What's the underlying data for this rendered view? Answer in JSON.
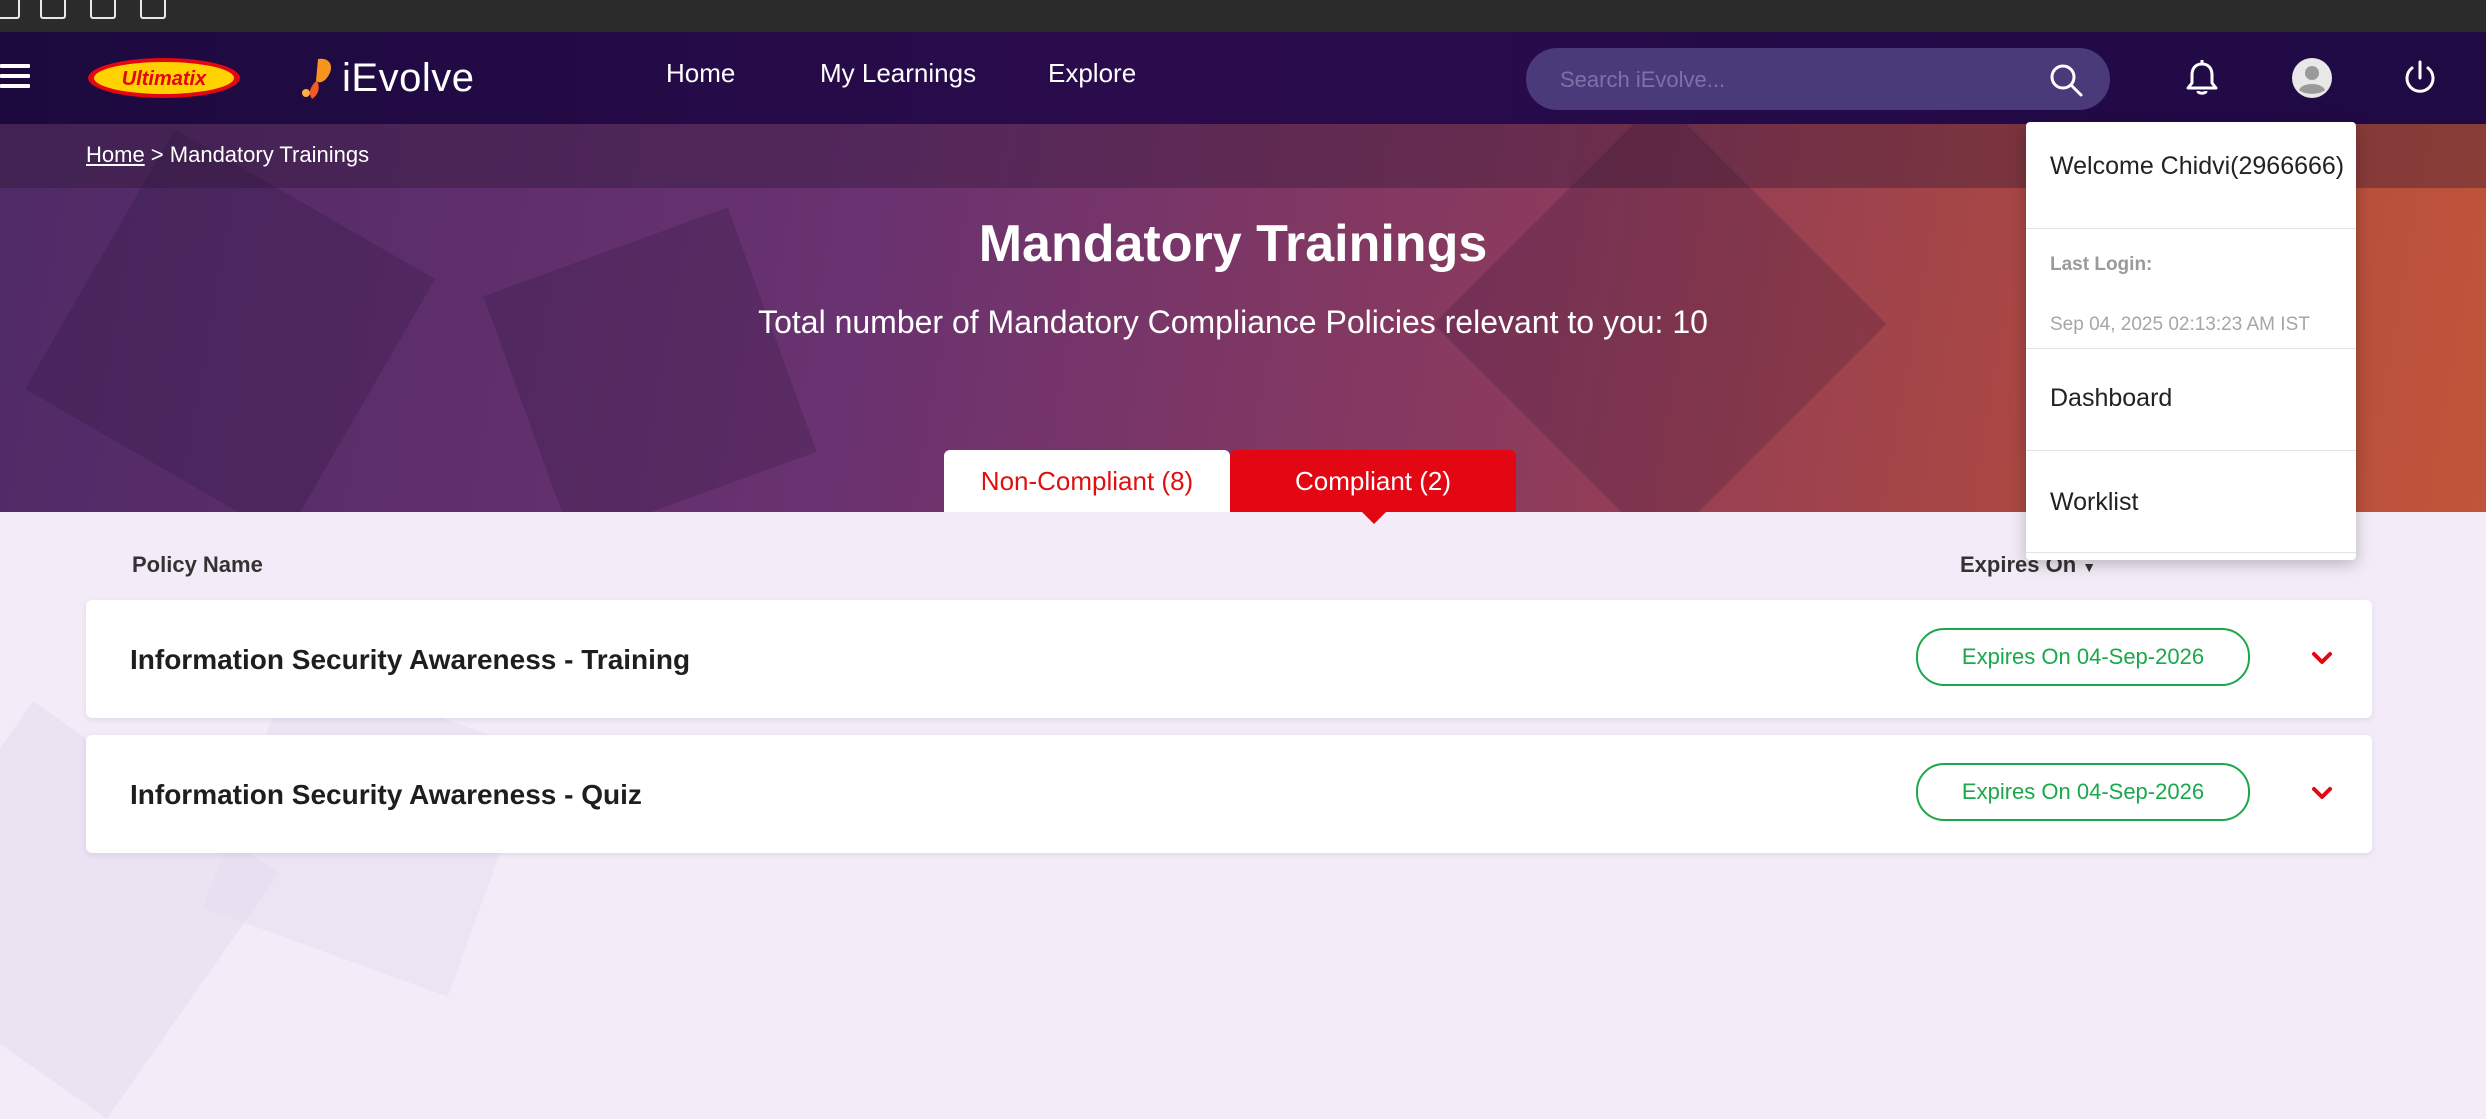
{
  "navbar": {
    "logo_ultimatix": "Ultimatix",
    "logo_ievolve": "iEvolve",
    "links": [
      "Home",
      "My Learnings",
      "Explore"
    ],
    "search_placeholder": "Search iEvolve..."
  },
  "breadcrumb": {
    "home": "Home",
    "separator": " > ",
    "current": "Mandatory Trainings"
  },
  "hero": {
    "title": "Mandatory Trainings",
    "subtitle": "Total number of Mandatory Compliance Policies relevant to you: 10"
  },
  "tabs": [
    {
      "label": "Non-Compliant (8)",
      "active": false
    },
    {
      "label": "Compliant (2)",
      "active": true
    }
  ],
  "columns": {
    "policy_name": "Policy Name",
    "expires_on": "Expires On"
  },
  "policies": [
    {
      "name": "Information Security Awareness - Training",
      "expiry": "Expires On 04-Sep-2026"
    },
    {
      "name": "Information Security Awareness - Quiz",
      "expiry": "Expires On 04-Sep-2026"
    }
  ],
  "user_menu": {
    "welcome": "Welcome Chidvi(2966666)",
    "last_login_label": "Last Login:",
    "last_login_value": "Sep 04, 2025 02:13:23 AM IST",
    "items": [
      "Dashboard",
      "Worklist"
    ]
  },
  "colors": {
    "navbar": "#1c0a3e",
    "accent_red": "#e30613",
    "badge_green": "#1aa84b"
  }
}
